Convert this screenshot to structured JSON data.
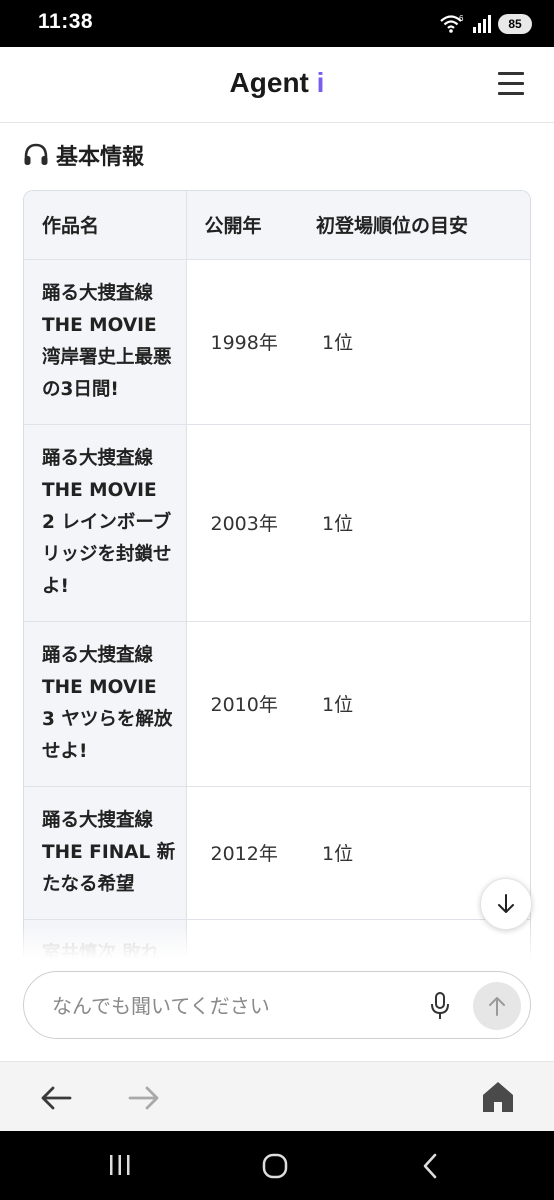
{
  "status_bar": {
    "time": "11:38",
    "battery": "85",
    "network_badge": "6"
  },
  "header": {
    "brand_main": "Agent",
    "brand_accent": "i",
    "brand_accent_color": "#7b5cf0"
  },
  "section": {
    "icon": "headphones-icon",
    "title": "基本情報"
  },
  "table": {
    "headers": [
      "作品名",
      "公開年",
      "初登場順位の目安"
    ],
    "rows": [
      {
        "title": "踊る大捜査線 THE MOVIE 湾岸署史上最悪の3日間!",
        "year": "1998年",
        "rank": "1位"
      },
      {
        "title": "踊る大捜査線 THE MOVIE 2 レインボーブリッジを封鎖せよ!",
        "year": "2003年",
        "rank": "1位"
      },
      {
        "title": "踊る大捜査線 THE MOVIE 3 ヤツらを解放せよ!",
        "year": "2010年",
        "rank": "1位"
      },
      {
        "title": "踊る大捜査線 THE FINAL 新たなる希望",
        "year": "2012年",
        "rank": "1位"
      }
    ],
    "partial_row_title": "室井慎次 敗れ"
  },
  "input": {
    "placeholder": "なんでも聞いてください"
  }
}
